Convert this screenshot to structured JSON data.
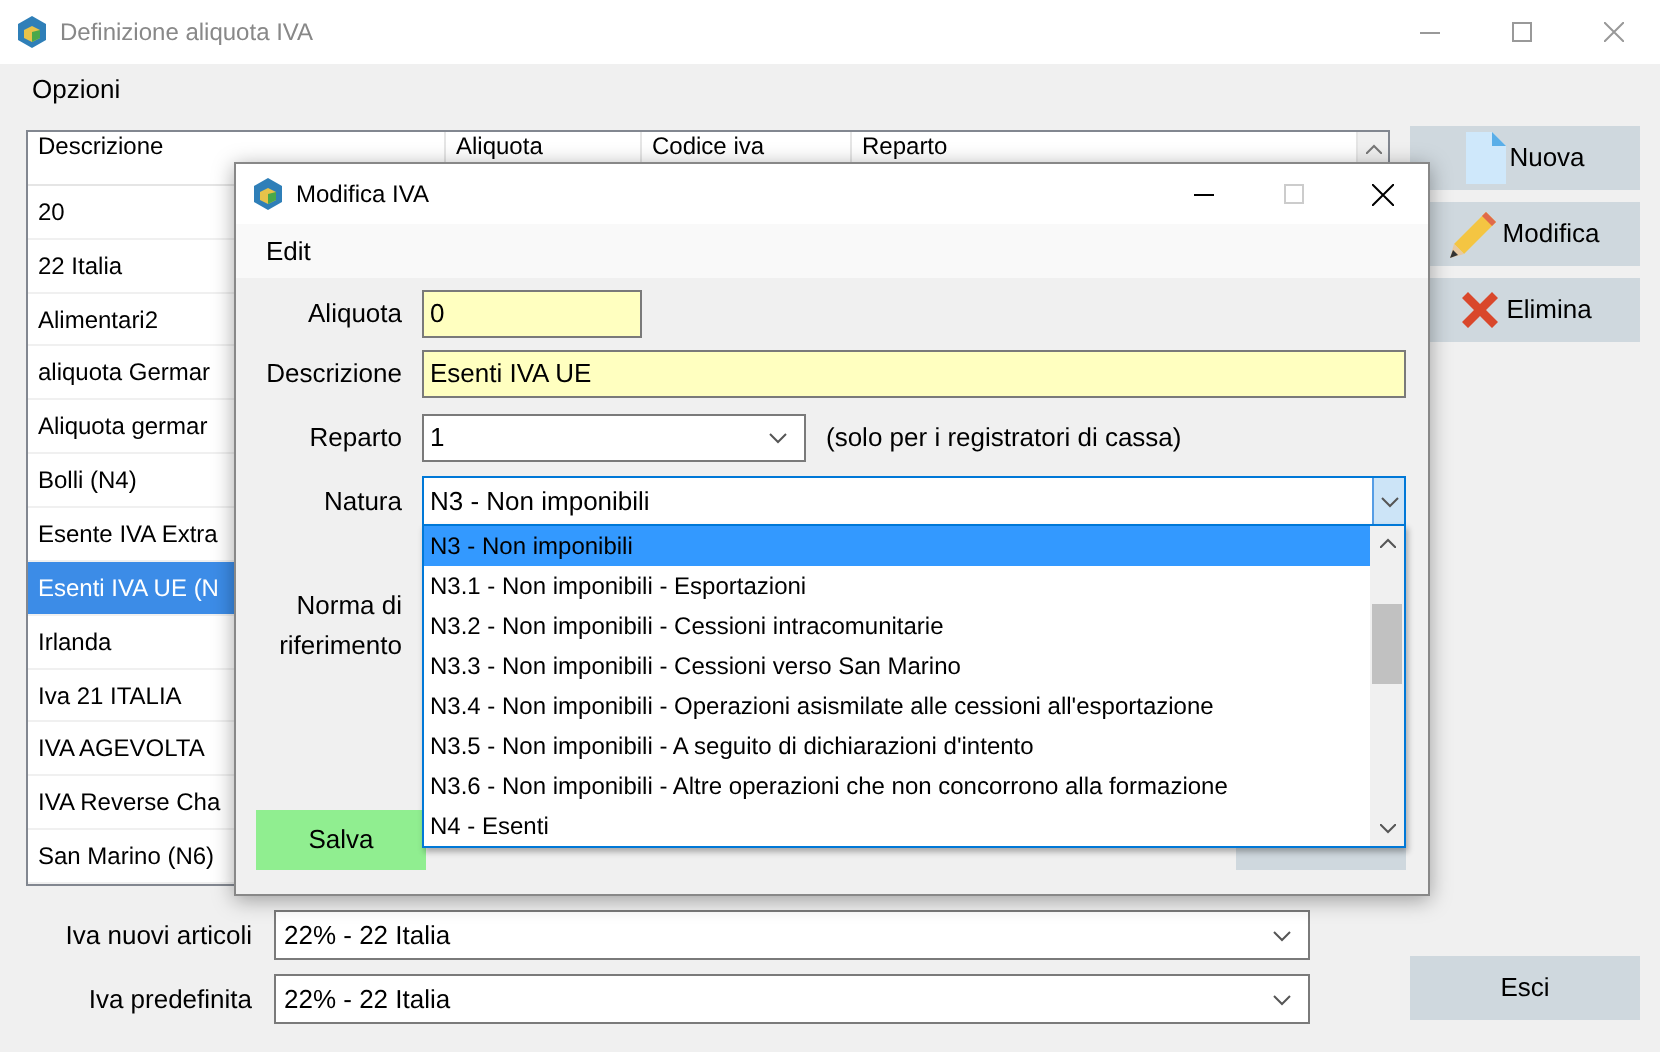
{
  "window": {
    "title": "Definizione aliquota IVA"
  },
  "menu": [
    "Opzioni"
  ],
  "table": {
    "columns": [
      "Descrizione",
      "Aliquota",
      "Codice iva",
      "Reparto"
    ],
    "rows": [
      {
        "text": "20",
        "selected": false
      },
      {
        "text": "22 Italia",
        "selected": false
      },
      {
        "text": "Alimentari2",
        "selected": false
      },
      {
        "text": "aliquota Germar",
        "selected": false
      },
      {
        "text": "Aliquota germar",
        "selected": false
      },
      {
        "text": "Bolli (N4)",
        "selected": false
      },
      {
        "text": "Esente IVA Extra",
        "selected": false
      },
      {
        "text": "Esenti IVA UE  (N",
        "selected": true
      },
      {
        "text": "Irlanda",
        "selected": false
      },
      {
        "text": "Iva 21 ITALIA",
        "selected": false
      },
      {
        "text": "IVA AGEVOLTA",
        "selected": false
      },
      {
        "text": "IVA Reverse Cha",
        "selected": false
      },
      {
        "text": "San Marino (N6)",
        "selected": false
      }
    ]
  },
  "actions": [
    {
      "label": "Nuova",
      "kind": "new"
    },
    {
      "label": "Modifica",
      "kind": "edit"
    },
    {
      "label": "Elimina",
      "kind": "delete"
    }
  ],
  "defaults": [
    {
      "label": "Iva nuovi articoli",
      "value": "22% - 22 Italia"
    },
    {
      "label": "Iva predefinita",
      "value": "22% - 22 Italia"
    }
  ],
  "exit_button": "Esci",
  "dialog": {
    "title": "Modifica IVA",
    "menu": [
      "Edit"
    ],
    "fields": [
      {
        "label": "Aliquota",
        "value": "0",
        "kind": "text"
      },
      {
        "label": "Descrizione",
        "value": "Esenti IVA UE",
        "kind": "text"
      },
      {
        "label": "Reparto",
        "value": "1",
        "kind": "select",
        "note": "(solo per i registratori di cassa)"
      }
    ],
    "natura": {
      "label": "Natura",
      "value": "N3 - Non imponibili",
      "expanded": true,
      "options": [
        {
          "label": "N3 - Non imponibili",
          "selected": true
        },
        {
          "label": "N3.1 - Non imponibili - Esportazioni",
          "selected": false
        },
        {
          "label": "N3.2 - Non imponibili - Cessioni intracomunitarie",
          "selected": false
        },
        {
          "label": "N3.3 - Non imponibili - Cessioni verso San Marino",
          "selected": false
        },
        {
          "label": "N3.4 - Non imponibili - Operazioni asismilate alle cessioni all'esportazione",
          "selected": false
        },
        {
          "label": "N3.5 - Non imponibili - A seguito di dichiarazioni d'intento",
          "selected": false
        },
        {
          "label": "N3.6 - Non imponibili - Altre operazioni che non concorrono alla formazione",
          "selected": false
        },
        {
          "label": "N4 - Esenti",
          "selected": false
        }
      ]
    },
    "norma_label": "Norma di riferimento",
    "save_button": "Salva"
  }
}
